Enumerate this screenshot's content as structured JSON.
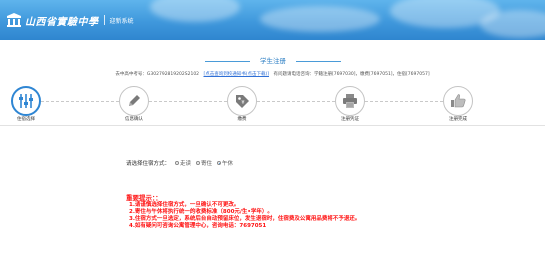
{
  "header": {
    "school_name": "山西省實驗中學",
    "system_name": "迎新系统",
    "colors": {
      "top": "#5fb4ec",
      "bottom": "#2f86cf"
    },
    "logo_icon": "school-logo-icon"
  },
  "page": {
    "title": "学生注册",
    "accent_color": "#2f86d3"
  },
  "info": {
    "exam_no_label": "去中高中考号：",
    "exam_no_value": "G302792819202S2102",
    "download_link": "[点击查询到校通知书(点击下载)]",
    "contact_prefix": "有问题请电话咨询：学籍注册[7697030]，缴费[7697051]，住宿[7697057]"
  },
  "steps": [
    {
      "label": "住宿选择",
      "icon": "bars-slider-icon",
      "active": true
    },
    {
      "label": "信息确认",
      "icon": "pencil-icon",
      "active": false
    },
    {
      "label": "缴费",
      "icon": "price-tag-icon",
      "active": false
    },
    {
      "label": "注册凭证",
      "icon": "printer-icon",
      "active": false
    },
    {
      "label": "注册完成",
      "icon": "thumbs-up-icon",
      "active": false
    }
  ],
  "lodging": {
    "label": "请选择住宿方式：",
    "options": [
      {
        "label": "走读",
        "checked": false
      },
      {
        "label": "寄住",
        "checked": false
      },
      {
        "label": "午休",
        "checked": true
      }
    ]
  },
  "notice": {
    "title": "重要提示：：",
    "lines": [
      "1.请谨慎选择住宿方式，一旦确认不可更改。",
      "2.寄住与午休将执行统一的收费标准（800元/生•学年）。",
      "3.住宿方式一旦选定，系统后台自动预留床位，发生退宿时，住宿费及公寓用品费将不予退还。",
      "4.如有疑问可咨询公寓管理中心，咨询电话：7697051"
    ],
    "color": "#ff1212"
  }
}
